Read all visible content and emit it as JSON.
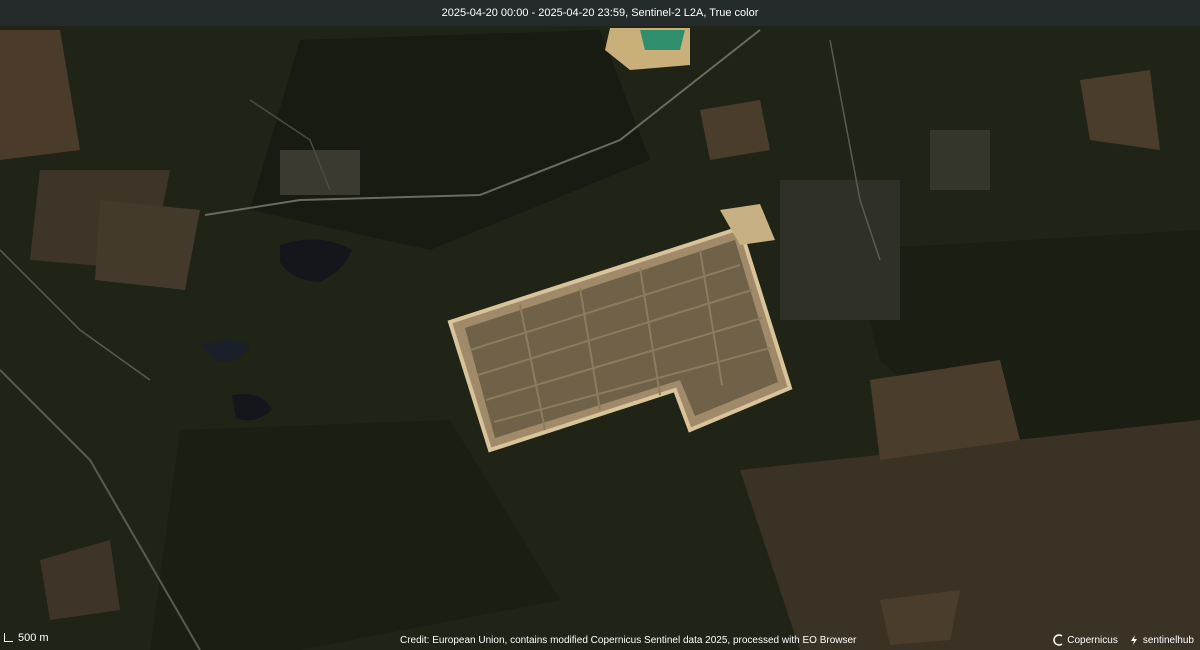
{
  "header": {
    "title": "2025-04-20 00:00 - 2025-04-20 23:59, Sentinel-2 L2A, True color"
  },
  "scale_bar": {
    "label": "500 m"
  },
  "footer": {
    "credit": "Credit: European Union, contains modified Copernicus Sentinel data 2025, processed with EO Browser",
    "logo_copernicus": "Copernicus",
    "logo_sentinelhub": "sentinelhub"
  },
  "colors": {
    "forest": "#1f2417",
    "field": "#4a3d2c",
    "facility": "#a08a6a",
    "water": "#1b1f2a",
    "lake_water": "#2e8f6a"
  }
}
